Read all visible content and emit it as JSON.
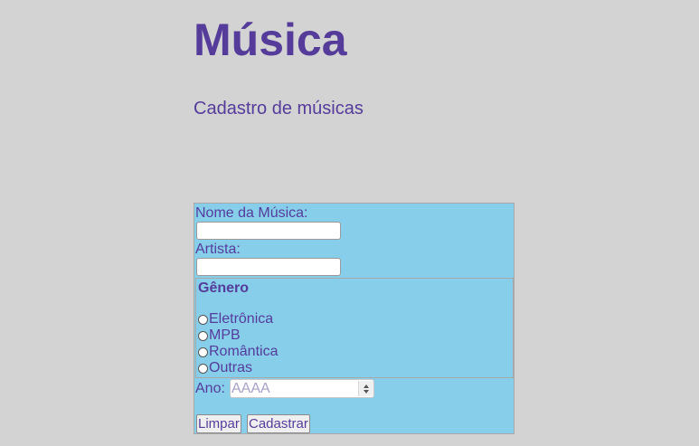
{
  "header": {
    "title": "Música",
    "subtitle": "Cadastro de músicas"
  },
  "form": {
    "name_label": "Nome da Música:",
    "name_value": "",
    "artist_label": "Artista:",
    "artist_value": "",
    "genre": {
      "legend": "Gênero",
      "options": [
        {
          "label": "Eletrônica",
          "checked": false
        },
        {
          "label": "MPB",
          "checked": false
        },
        {
          "label": "Romântica",
          "checked": false
        },
        {
          "label": "Outras",
          "checked": false
        }
      ]
    },
    "year_label": "Ano:",
    "year_placeholder": "AAAA",
    "year_value": "",
    "reset_label": "Limpar",
    "submit_label": "Cadastrar"
  },
  "colors": {
    "page_background": "#d3d3d3",
    "panel_background": "#87ceeb",
    "text": "#553c9a"
  }
}
